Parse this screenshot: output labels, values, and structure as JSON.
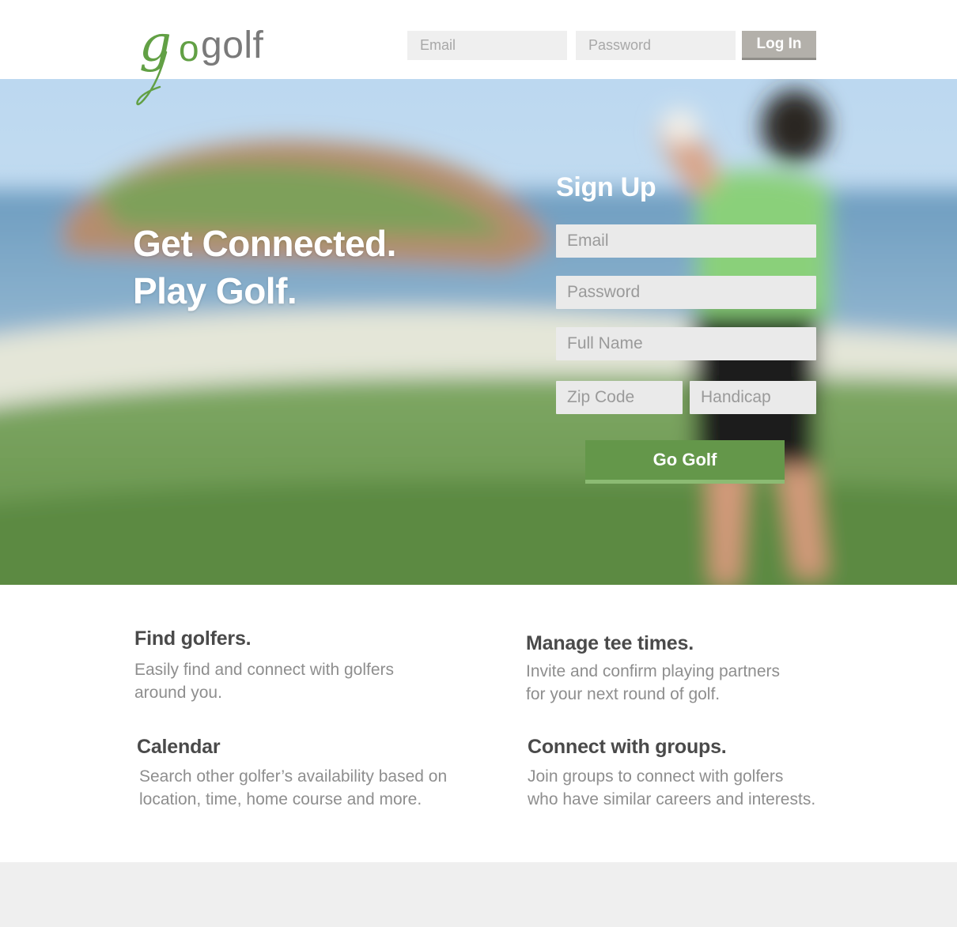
{
  "logo": {
    "text": "gogolf",
    "go_g": "g",
    "go_o": "o",
    "golf": "golf"
  },
  "login": {
    "email_placeholder": "Email",
    "password_placeholder": "Password",
    "button_label": "Log In"
  },
  "hero": {
    "headline_line1": "Get Connected.",
    "headline_line2": "Play Golf."
  },
  "signup": {
    "title": "Sign Up",
    "email_placeholder": "Email",
    "password_placeholder": "Password",
    "fullname_placeholder": "Full Name",
    "zip_placeholder": "Zip Code",
    "handicap_placeholder": "Handicap",
    "button_label": "Go Golf"
  },
  "features": [
    {
      "title": "Find golfers.",
      "description": "Easily find and connect with golfers\naround you."
    },
    {
      "title": "Manage tee times.",
      "description": "Invite and confirm playing partners\nfor your next round of golf."
    },
    {
      "title": "Calendar",
      "description": "Search other golfer’s availability based on\nlocation, time, home course and more."
    },
    {
      "title": "Connect with groups.",
      "description": "Join groups to connect with  golfers\nwho have similar careers and interests."
    }
  ],
  "colors": {
    "brand_green": "#62a045",
    "button_green": "#64974a",
    "login_button": "#b3b0aa",
    "footer_bg": "#efefef"
  }
}
